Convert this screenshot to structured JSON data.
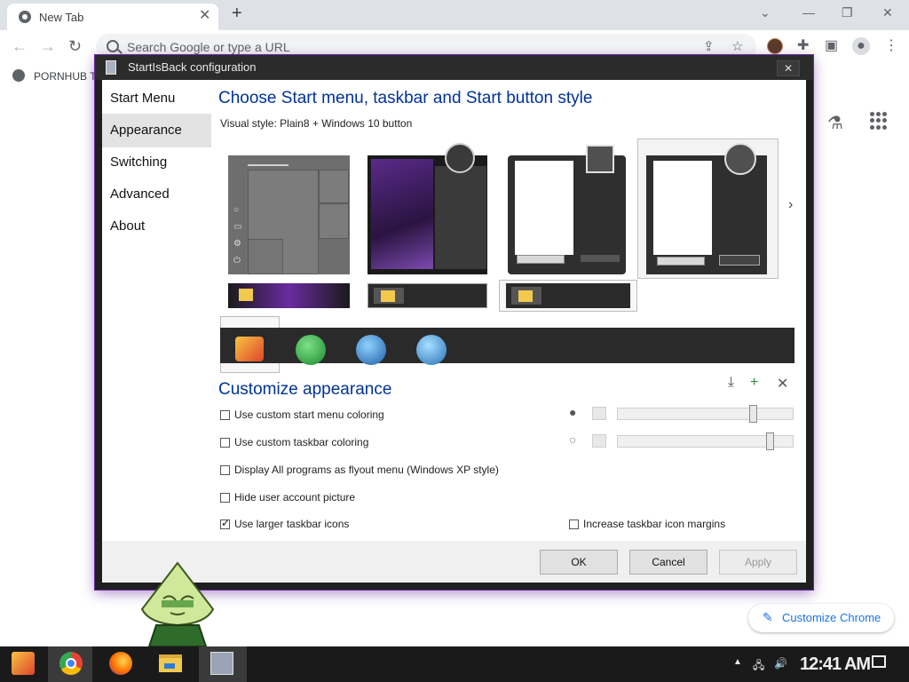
{
  "browser": {
    "tab_title": "New Tab",
    "omnibox_placeholder": "Search Google or type a URL",
    "bookmark_label": "PORNHUB T",
    "customize_chrome_label": "Customize Chrome"
  },
  "dialog": {
    "title": "StartIsBack configuration",
    "close_label": "✕",
    "nav": [
      "Start Menu",
      "Appearance",
      "Switching",
      "Advanced",
      "About"
    ],
    "active_nav": "Appearance",
    "heading_style": "Choose Start menu, taskbar and Start button style",
    "visual_style_label": "Visual style:",
    "visual_style_value": "Plain8 + Windows 10 button",
    "heading_customize": "Customize appearance",
    "options": {
      "custom_start_coloring": {
        "label": "Use custom start menu coloring",
        "checked": false
      },
      "custom_taskbar_coloring": {
        "label": "Use custom taskbar coloring",
        "checked": false
      },
      "flyout_menu": {
        "label": "Display All programs as flyout menu (Windows XP style)",
        "checked": false
      },
      "hide_account_picture": {
        "label": "Hide user account picture",
        "checked": false
      },
      "larger_taskbar_icons": {
        "label": "Use larger taskbar icons",
        "checked": true
      },
      "icon_margins": {
        "label": "Increase taskbar icon margins",
        "checked": false
      }
    },
    "sliders": {
      "start_menu_opacity": 0.78,
      "taskbar_opacity": 0.88
    },
    "buttons": {
      "ok": "OK",
      "cancel": "Cancel",
      "apply": "Apply"
    }
  },
  "taskbar": {
    "clock": "12:41 AM",
    "apps": [
      "startisback-orb",
      "chrome",
      "firefox",
      "file-explorer",
      "startisback-config"
    ]
  },
  "colors": {
    "heading_blue": "#003399",
    "dialog_frame": "#1f1f1f",
    "accent_purple": "#6a2ba0",
    "chrome_link_blue": "#1a73e8"
  }
}
